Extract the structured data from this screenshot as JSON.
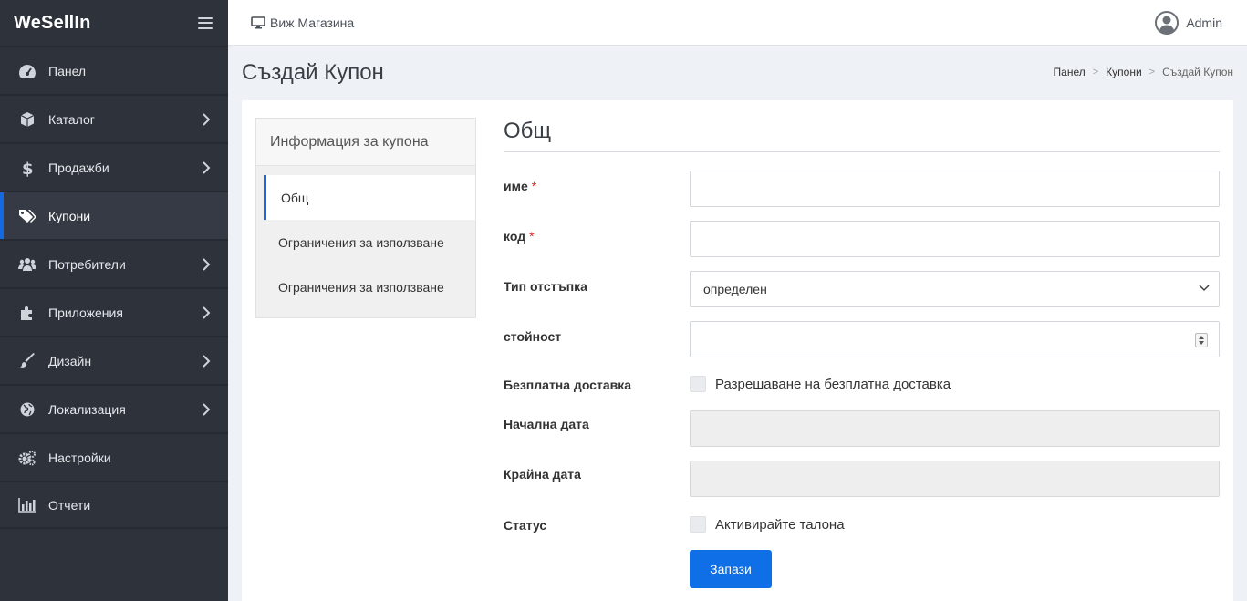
{
  "brand": {
    "name": "WeSellIn"
  },
  "sidebar": {
    "items": [
      {
        "label": "Панел",
        "icon": "dashboard-icon",
        "has_children": false,
        "active": false
      },
      {
        "label": "Каталог",
        "icon": "cube-icon",
        "has_children": true,
        "active": false
      },
      {
        "label": "Продажби",
        "icon": "dollar-icon",
        "has_children": true,
        "active": false
      },
      {
        "label": "Купони",
        "icon": "tags-icon",
        "has_children": false,
        "active": true
      },
      {
        "label": "Потребители",
        "icon": "users-icon",
        "has_children": true,
        "active": false
      },
      {
        "label": "Приложения",
        "icon": "puzzle-icon",
        "has_children": true,
        "active": false
      },
      {
        "label": "Дизайн",
        "icon": "paintbrush-icon",
        "has_children": true,
        "active": false
      },
      {
        "label": "Локализация",
        "icon": "globe-icon",
        "has_children": true,
        "active": false
      },
      {
        "label": "Настройки",
        "icon": "gears-icon",
        "has_children": false,
        "active": false
      },
      {
        "label": "Отчети",
        "icon": "bar-chart-icon",
        "has_children": false,
        "active": false
      }
    ]
  },
  "topbar": {
    "view_store": "Виж Магазина",
    "user": "Admin"
  },
  "page": {
    "title": "Създай Купон",
    "breadcrumb": [
      "Панел",
      "Купони",
      "Създай Купон"
    ]
  },
  "tabs": {
    "header": "Информация за купона",
    "items": [
      "Общ",
      "Ограничения за използване",
      "Ограничения за използване"
    ]
  },
  "form": {
    "section_title": "Общ",
    "name_label": "име",
    "code_label": "код",
    "discount_type_label": "Тип отстъпка",
    "discount_type_value": "определен",
    "value_label": "стойност",
    "free_shipping_label": "Безплатна доставка",
    "free_shipping_check": "Разрешаване на безплатна доставка",
    "start_date_label": "Начална дата",
    "end_date_label": "Крайна дата",
    "status_label": "Статус",
    "status_check": "Активирайте талона",
    "save": "Запази",
    "required_mark": "*"
  },
  "colors": {
    "sidebar_bg": "#2d323b",
    "accent": "#1469e0",
    "button": "#0f6fe6",
    "required": "#e02424"
  }
}
